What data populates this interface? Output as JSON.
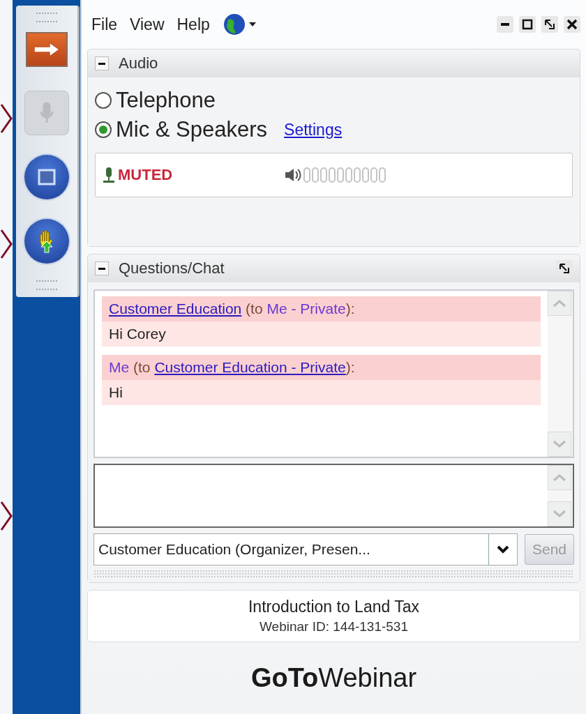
{
  "side_toolbar": {
    "buttons": [
      {
        "kind": "arrow",
        "disabled": false
      },
      {
        "kind": "mic",
        "disabled": true
      },
      {
        "kind": "screen",
        "disabled": false
      },
      {
        "kind": "hand",
        "disabled": false
      }
    ]
  },
  "menu": {
    "items": [
      "File",
      "View",
      "Help"
    ]
  },
  "audio": {
    "title": "Audio",
    "options": [
      {
        "label": "Telephone",
        "selected": false
      },
      {
        "label": "Mic & Speakers",
        "selected": true
      }
    ],
    "settings_link": "Settings",
    "status": "MUTED"
  },
  "chat": {
    "title": "Questions/Chat",
    "messages": [
      {
        "header": [
          {
            "kind": "link",
            "text": "Customer Education"
          },
          {
            "kind": "plain",
            "text": " (to "
          },
          {
            "kind": "name",
            "text": "Me - Private"
          },
          {
            "kind": "plain",
            "text": "):"
          }
        ],
        "body": "Hi Corey"
      },
      {
        "header": [
          {
            "kind": "name",
            "text": "Me"
          },
          {
            "kind": "plain",
            "text": " (to "
          },
          {
            "kind": "link",
            "text": "Customer Education - Private"
          },
          {
            "kind": "plain",
            "text": "):"
          }
        ],
        "body": "Hi"
      }
    ],
    "recipient": "Customer Education (Organizer, Presen...",
    "send_button": {
      "label": "Send",
      "disabled": true
    }
  },
  "webinar": {
    "title": "Introduction to Land Tax",
    "id_line": "Webinar ID: 144-131-531"
  },
  "brand": "**GoTo**Webinar"
}
